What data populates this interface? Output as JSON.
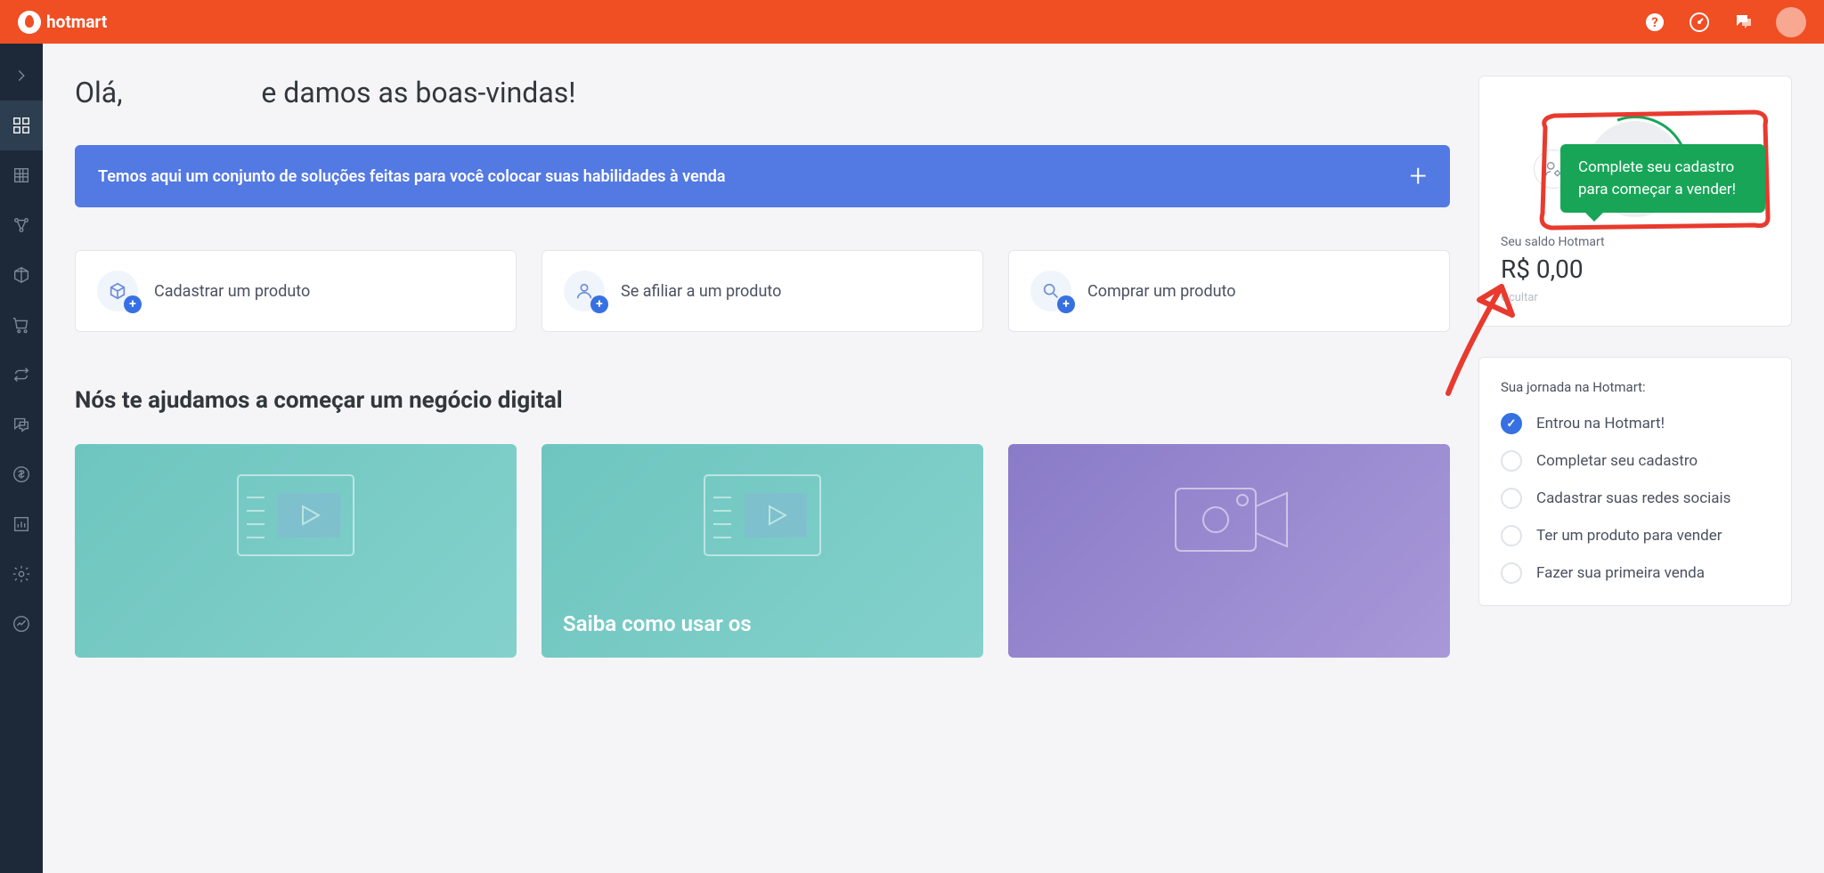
{
  "brand": "hotmart",
  "greeting_pre": "Olá,",
  "greeting_post": "e damos as boas-vindas!",
  "banner": {
    "text": "Temos aqui um conjunto de soluções feitas para você colocar suas habilidades à venda"
  },
  "actions": {
    "register": "Cadastrar um produto",
    "affiliate": "Se afiliar a um produto",
    "buy": "Comprar um produto"
  },
  "section_help_title": "Nós te ajudamos a começar um negócio digital",
  "learn_cards": {
    "card2_title": "Saiba como usar os"
  },
  "tooltip": "Complete seu cadastro para começar a vender!",
  "balance": {
    "label": "Seu saldo Hotmart",
    "value": "R$ 0,00",
    "hide": "Ocultar"
  },
  "journey": {
    "title": "Sua jornada na Hotmart:",
    "steps": {
      "s1": "Entrou na Hotmart!",
      "s2": "Completar seu cadastro",
      "s3": "Cadastrar suas redes sociais",
      "s4": "Ter um produto para vender",
      "s5": "Fazer sua primeira venda"
    }
  }
}
